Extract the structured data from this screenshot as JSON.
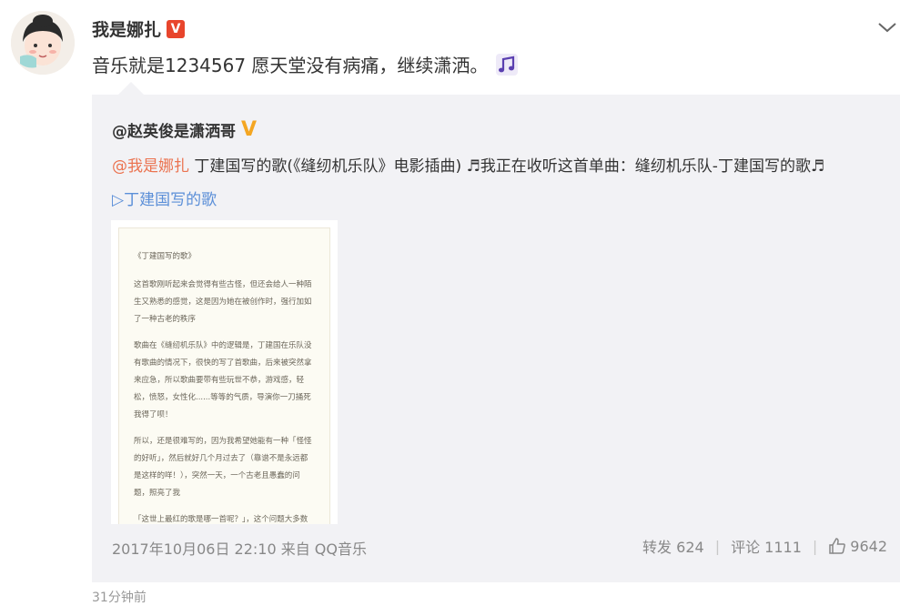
{
  "post": {
    "author": "我是娜扎",
    "verified_badge": "V",
    "text": "音乐就是1234567 愿天堂没有病痛，继续潇洒。",
    "reposted": {
      "author": "@赵英俊是潇洒哥",
      "mention": "@我是娜扎",
      "text": " 丁建国写的歌(《缝纫机乐队》电影插曲) ♬我正在收听这首单曲：缝纫机乐队-丁建国写的歌♬",
      "music_link": "▷丁建国写的歌",
      "card": {
        "title": "《丁建国写的歌》",
        "paragraphs": [
          "这首歌刚听起来会觉得有些古怪，但还会给人一种陌生又熟悉的感觉，这是因为她在被创作时，强行加如了一种古老的秩序",
          "歌曲在《缝纫机乐队》中的逻辑是，丁建国在乐队没有歌曲的情况下，很快的写了首歌曲，后来被突然拿来应急，所以歌曲要带有些玩世不恭，游戏感，轻松，愤怒，女性化......等等的气质，导演你一刀捅死我得了呗！",
          "所以，还是很难写的，因为我希望她能有一种「怪怪的好听」，然后就好几个月过去了（靠谱不是永远都是这样的咩！），突然一天，一个古老且愚蠢的问题，照亮了我",
          "「这世上最红的歌是哪一首呢？」，这个问题大多数人都会回答：祝你生日快乐，祝你生日......每个人都会唱，就是最红嘛！但那这种人呢，你懂"
        ]
      },
      "timestamp": "2017年10月06日 22:10 来自 QQ音乐",
      "repost_label": "转发 624",
      "comment_label": "评论 1111",
      "like_count": "9642"
    }
  },
  "bottom_partial": "31分钟前",
  "colors": {
    "mention": "#eb7350",
    "link": "#5b8fd8",
    "repost_bg": "#f2f2f5",
    "verified_red": "#e8452c",
    "verified_gold": "#f4a622"
  },
  "icons": [
    "avatar-illustration",
    "verified-badge-icon",
    "music-note-icon",
    "chevron-down-icon",
    "gold-v-icon",
    "thumbs-up-icon"
  ]
}
